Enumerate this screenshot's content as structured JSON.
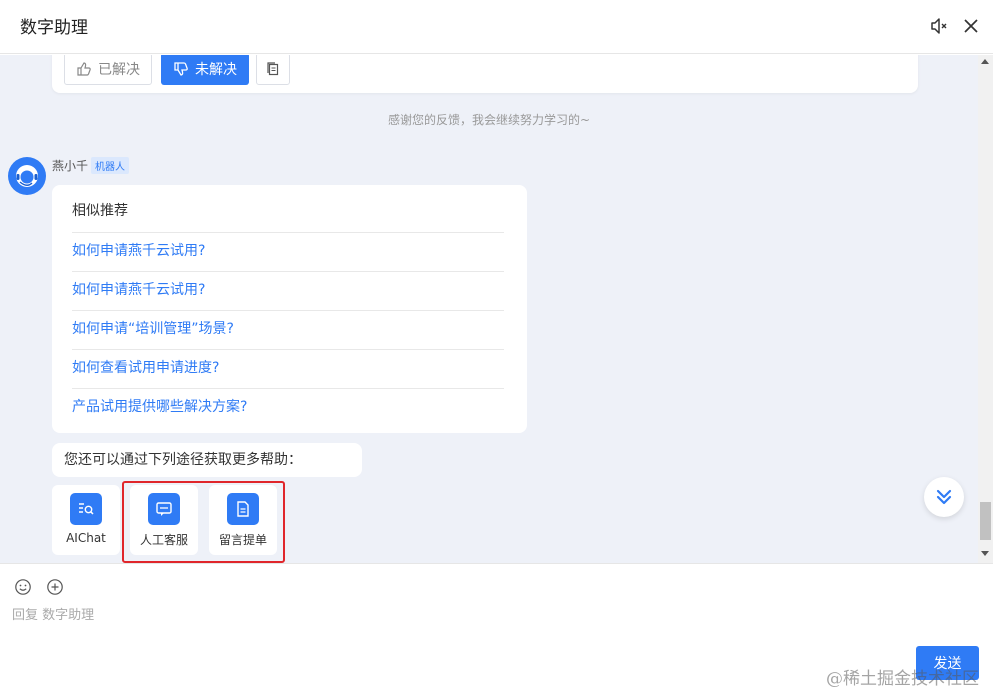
{
  "header": {
    "title": "数字助理"
  },
  "feedback": {
    "resolved_label": "已解决",
    "unresolved_label": "未解决"
  },
  "thanks_text": "感谢您的反馈，我会继续努力学习的~",
  "bot": {
    "name": "燕小千",
    "tag": "机器人"
  },
  "recommend": {
    "title": "相似推荐",
    "items": [
      "如何申请燕千云试用?",
      "如何申请燕千云试用?",
      "如何申请“培训管理”场景?",
      "如何查看试用申请进度?",
      "产品试用提供哪些解决方案?"
    ]
  },
  "more_help": "您还可以通过下列途径获取更多帮助：",
  "quick_actions": [
    {
      "label": "AIChat",
      "icon": "search-list-icon"
    },
    {
      "label": "人工客服",
      "icon": "chat-bubble-icon"
    },
    {
      "label": "留言提单",
      "icon": "document-icon"
    }
  ],
  "composer": {
    "placeholder": "回复 数字助理",
    "send_label": "发送"
  },
  "watermark": "@稀土掘金技术社区",
  "colors": {
    "accent": "#2f7bf5",
    "highlight": "#e0262b",
    "chat_bg": "#eef1f8"
  }
}
